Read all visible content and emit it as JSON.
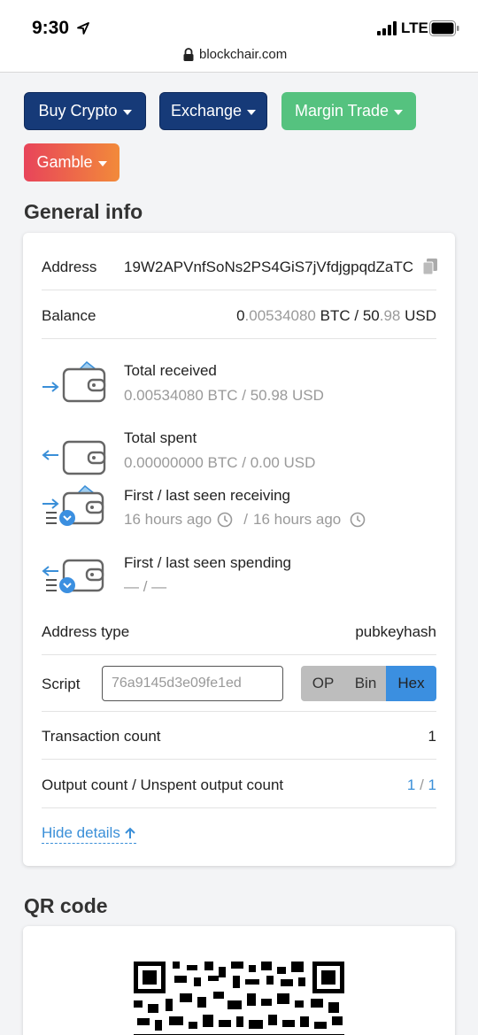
{
  "status_bar": {
    "time": "9:30",
    "network": "LTE"
  },
  "browser": {
    "url": "blockchair.com"
  },
  "nav_buttons": [
    {
      "label": "Buy Crypto"
    },
    {
      "label": "Exchange"
    },
    {
      "label": "Margin Trade"
    },
    {
      "label": "Gamble"
    }
  ],
  "general_info": {
    "title": "General info",
    "address": {
      "label": "Address",
      "value": "19W2APVnfSoNs2PS4GiS7jVfdjgpqdZaTC"
    },
    "balance": {
      "label": "Balance",
      "btc_int": "0",
      "btc_dec": ".00534080",
      "btc_unit": " BTC / ",
      "usd_int": "50",
      "usd_dec": ".98",
      "usd_unit": " USD"
    },
    "total_received": {
      "label": "Total received",
      "value": "0.00534080 BTC / 50.98 USD"
    },
    "total_spent": {
      "label": "Total spent",
      "value": "0.00000000 BTC / 0.00 USD"
    },
    "first_last_receiving": {
      "label": "First / last seen receiving",
      "first": "16 hours ago",
      "sep": "/ ",
      "last": "16 hours ago"
    },
    "first_last_spending": {
      "label": "First / last seen spending",
      "value": "— / —"
    },
    "address_type": {
      "label": "Address type",
      "value": "pubkeyhash"
    },
    "script": {
      "label": "Script",
      "value": "76a9145d3e09fe1ed",
      "modes": [
        "OP",
        "Bin",
        "Hex"
      ],
      "active_mode": "Hex"
    },
    "transaction_count": {
      "label": "Transaction count",
      "value": "1"
    },
    "output_count": {
      "label": "Output count / Unspent output count",
      "outputs": "1",
      "sep": " / ",
      "unspent": "1"
    },
    "hide_details": "Hide details"
  },
  "qr": {
    "title": "QR code"
  },
  "colors": {
    "navy_button": "#163a78",
    "green_button": "#55c27f",
    "gamble_gradient_start": "#e8445a",
    "gamble_gradient_end": "#f28a3a",
    "link_blue": "#3a8fd8",
    "active_segment": "#3b8fe0"
  },
  "icons": [
    "location-arrow-icon",
    "signal-icon",
    "battery-icon",
    "lock-icon",
    "copy-icon",
    "wallet-received-icon",
    "wallet-spent-icon",
    "wallet-receiving-time-icon",
    "wallet-spending-time-icon",
    "clock-icon",
    "arrow-up-icon",
    "qr-code-image"
  ]
}
